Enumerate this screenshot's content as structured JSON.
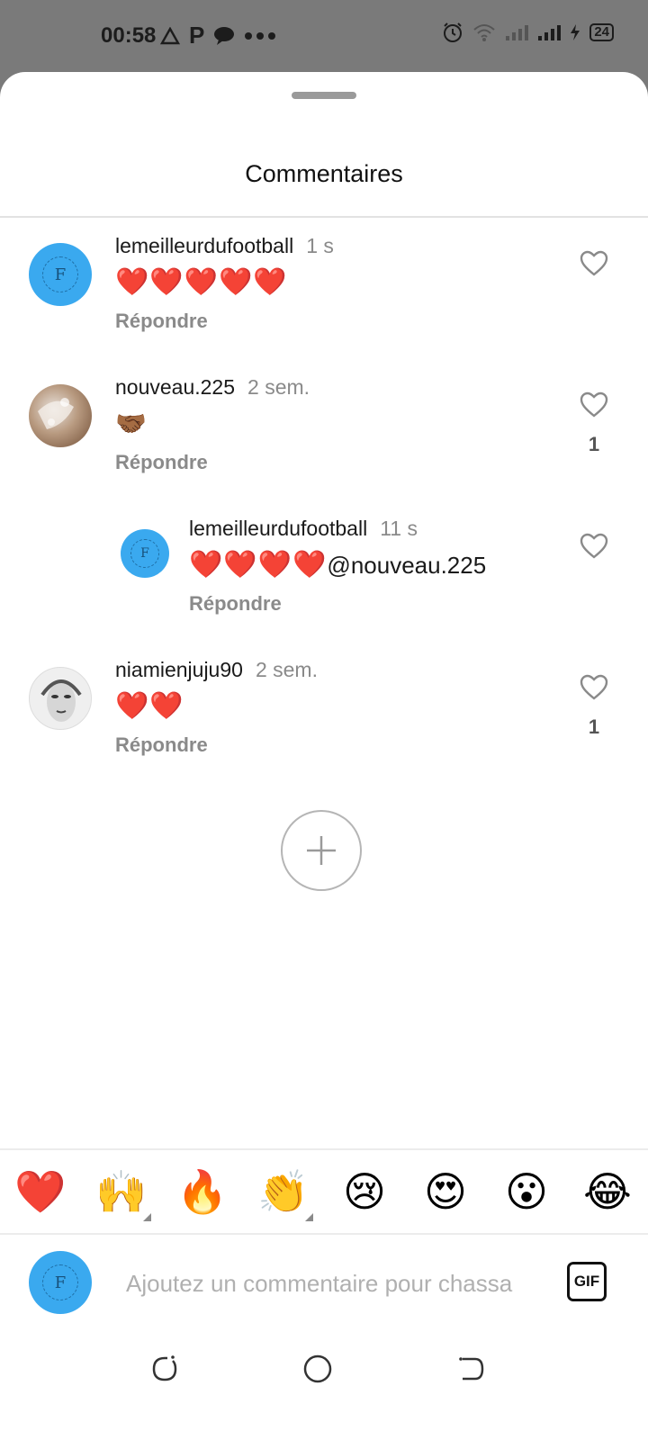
{
  "status_bar": {
    "time": "00:58",
    "battery": "24"
  },
  "sheet": {
    "title": "Commentaires"
  },
  "comments": [
    {
      "user": "lemeilleurdufootball",
      "time": "1 s",
      "text": "❤️❤️❤️❤️❤️",
      "reply_label": "Répondre",
      "likes": "",
      "avatar_letter": "F",
      "avatar": "blue-logo"
    },
    {
      "user": "nouveau.225",
      "time": "2 sem.",
      "text": "🤝🏾",
      "reply_label": "Répondre",
      "likes": "1",
      "avatar": "photo-hands"
    },
    {
      "user": "lemeilleurdufootball",
      "time": "11 s",
      "text_hearts": "❤️❤️❤️❤️",
      "text_mention": "@nouveau.225",
      "reply_label": "Répondre",
      "likes": "",
      "avatar_letter": "F",
      "avatar": "blue-logo"
    },
    {
      "user": "niamienjuju90",
      "time": "2 sem.",
      "text": "❤️❤️",
      "reply_label": "Répondre",
      "likes": "1",
      "avatar": "photo-portrait"
    }
  ],
  "emoji_bar": [
    "❤️",
    "🙌",
    "🔥",
    "👏",
    "😢",
    "😍",
    "😮",
    "😂"
  ],
  "composer": {
    "avatar_letter": "F",
    "placeholder": "Ajoutez un commentaire pour chassa",
    "gif_label": "GIF"
  },
  "colors": {
    "avatar_blue": "#3aa9ef",
    "heart_red": "#e0182b",
    "muted_text": "#8a8a8a"
  }
}
